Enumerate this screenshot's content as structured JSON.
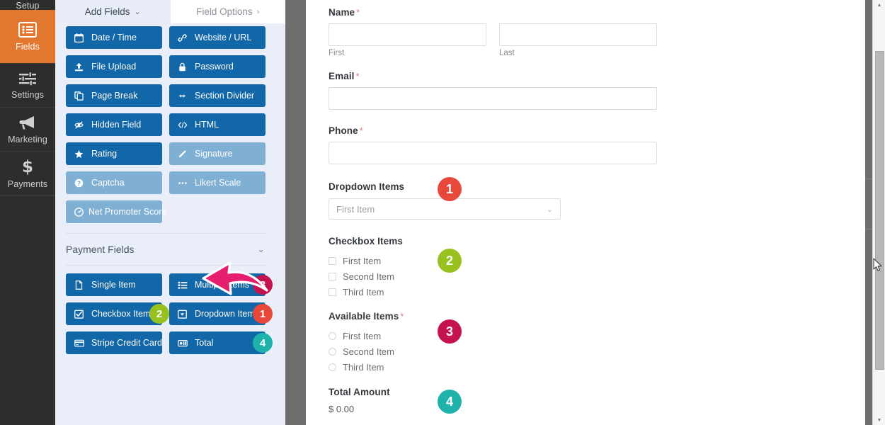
{
  "sidebar": {
    "items": [
      {
        "id": "setup",
        "label": "Setup",
        "icon": "wrench-icon",
        "active": false
      },
      {
        "id": "fields",
        "label": "Fields",
        "icon": "list-icon",
        "active": true
      },
      {
        "id": "settings",
        "label": "Settings",
        "icon": "sliders-icon",
        "active": false
      },
      {
        "id": "marketing",
        "label": "Marketing",
        "icon": "megaphone-icon",
        "active": false
      },
      {
        "id": "payments",
        "label": "Payments",
        "icon": "dollar-icon",
        "active": false
      }
    ]
  },
  "fields_panel": {
    "tabs": [
      {
        "id": "add-fields",
        "label": "Add Fields",
        "caret": "⌄",
        "active": true
      },
      {
        "id": "field-options",
        "label": "Field Options",
        "caret": "›",
        "active": false
      }
    ],
    "standard_fields": [
      {
        "label": "Date / Time",
        "icon": "calendar-icon",
        "pro": false
      },
      {
        "label": "Website / URL",
        "icon": "link-icon",
        "pro": false
      },
      {
        "label": "File Upload",
        "icon": "upload-icon",
        "pro": false
      },
      {
        "label": "Password",
        "icon": "lock-icon",
        "pro": false
      },
      {
        "label": "Page Break",
        "icon": "pages-icon",
        "pro": false
      },
      {
        "label": "Section Divider",
        "icon": "arrows-h-icon",
        "pro": false
      },
      {
        "label": "Hidden Field",
        "icon": "eye-slash-icon",
        "pro": false
      },
      {
        "label": "HTML",
        "icon": "code-icon",
        "pro": false
      },
      {
        "label": "Rating",
        "icon": "star-icon",
        "pro": false
      },
      {
        "label": "Signature",
        "icon": "pencil-icon",
        "pro": true
      },
      {
        "label": "Captcha",
        "icon": "question-icon",
        "pro": true
      },
      {
        "label": "Likert Scale",
        "icon": "dots-icon",
        "pro": true
      },
      {
        "label": "Net Promoter Score",
        "icon": "gauge-icon",
        "pro": true
      }
    ],
    "payment_section": {
      "title": "Payment Fields",
      "caret": "⌄"
    },
    "payment_fields": [
      {
        "label": "Single Item",
        "icon": "file-icon",
        "badge": null
      },
      {
        "label": "Multiple Items",
        "icon": "list-ul-icon",
        "badge": {
          "number": "3",
          "color": "#c4134e"
        }
      },
      {
        "label": "Checkbox Items",
        "icon": "check-square-icon",
        "badge": {
          "number": "2",
          "color": "#97c11f"
        }
      },
      {
        "label": "Dropdown Items",
        "icon": "caret-square-icon",
        "badge": {
          "number": "1",
          "color": "#e8483a"
        }
      },
      {
        "label": "Stripe Credit Card",
        "icon": "credit-card-icon",
        "badge": null
      },
      {
        "label": "Total",
        "icon": "total-icon",
        "badge": {
          "number": "4",
          "color": "#1fb2ab"
        }
      }
    ],
    "annotation": {
      "type": "pink-arrow",
      "color": "#e51f6e",
      "points_to": "Payment Fields"
    }
  },
  "preview": {
    "name": {
      "label": "Name",
      "required": "*",
      "first_sublabel": "First",
      "last_sublabel": "Last",
      "first_value": "",
      "last_value": ""
    },
    "email": {
      "label": "Email",
      "required": "*",
      "value": ""
    },
    "phone": {
      "label": "Phone",
      "required": "*",
      "value": ""
    },
    "dropdown_items": {
      "label": "Dropdown Items",
      "selected": "First Item",
      "caret": "⌄",
      "badge": {
        "number": "1",
        "color": "#e8483a"
      }
    },
    "checkbox_items": {
      "label": "Checkbox Items",
      "options": [
        "First Item",
        "Second Item",
        "Third Item"
      ],
      "badge": {
        "number": "2",
        "color": "#97c11f"
      }
    },
    "available_items": {
      "label": "Available Items",
      "required": "*",
      "options": [
        "First Item",
        "Second Item",
        "Third Item"
      ],
      "badge": {
        "number": "3",
        "color": "#c4134e"
      }
    },
    "total_amount": {
      "label": "Total Amount",
      "value": "$ 0.00",
      "badge": {
        "number": "4",
        "color": "#1fb2ab"
      }
    }
  },
  "scrollbars": {
    "fields_panel": {
      "up": "▲",
      "down": "▼"
    },
    "browser": {
      "up": "▲",
      "down": "▼"
    }
  }
}
